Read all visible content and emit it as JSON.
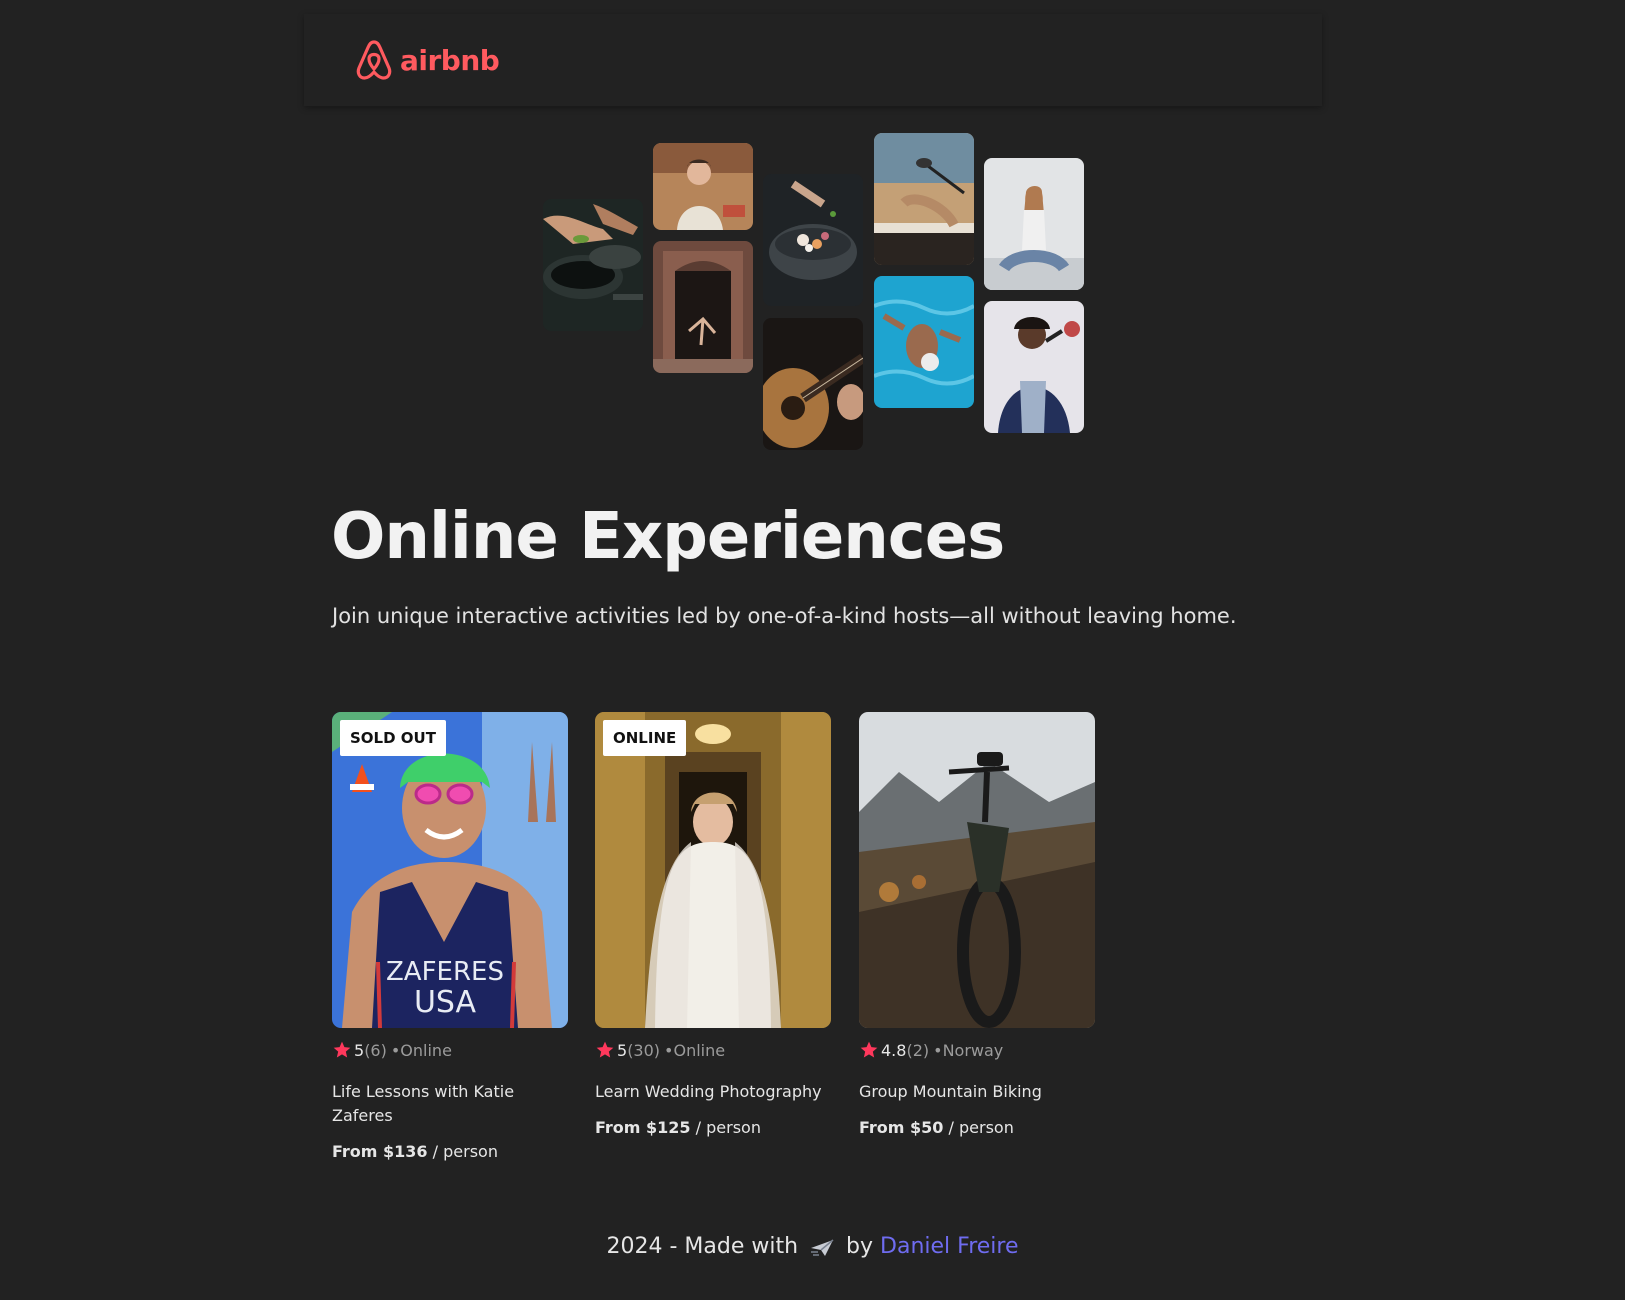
{
  "brand": {
    "name": "airbnb",
    "color": "#ff5a5f"
  },
  "hero": {
    "images": [
      {
        "name": "hero-img-cooking-pans"
      },
      {
        "name": "hero-img-woman-kitchen"
      },
      {
        "name": "hero-img-dancer-doorway"
      },
      {
        "name": "hero-img-food-bowl"
      },
      {
        "name": "hero-img-guitar"
      },
      {
        "name": "hero-img-piano-mic"
      },
      {
        "name": "hero-img-swimmer"
      },
      {
        "name": "hero-img-yoga"
      },
      {
        "name": "hero-img-singer"
      }
    ]
  },
  "main": {
    "title": "Online Experiences",
    "subtitle": "Join unique interactive activities led by one-of-a-kind hosts—all without leaving home."
  },
  "cards": [
    {
      "badge": "SOLD OUT",
      "rating": "5",
      "count": "(6)",
      "location": "Online",
      "title": "Life Lessons with Katie Zaferes",
      "price": "From $136",
      "unit": "/ person",
      "jersey_line1": "ZAFERES",
      "jersey_line2": "USA"
    },
    {
      "badge": "ONLINE",
      "rating": "5",
      "count": "(30)",
      "location": "Online",
      "title": "Learn Wedding Photography",
      "price": "From $125",
      "unit": "/ person"
    },
    {
      "badge": "",
      "rating": "4.8",
      "count": "(2)",
      "location": "Norway",
      "title": "Group Mountain Biking",
      "price": "From $50",
      "unit": "/ person"
    }
  ],
  "footer": {
    "prefix": "2024 - Made with",
    "by": "by",
    "author": "Daniel Freire",
    "author_color": "#6f6cf0"
  },
  "colors": {
    "background": "#222222",
    "star": "#ff385c"
  }
}
